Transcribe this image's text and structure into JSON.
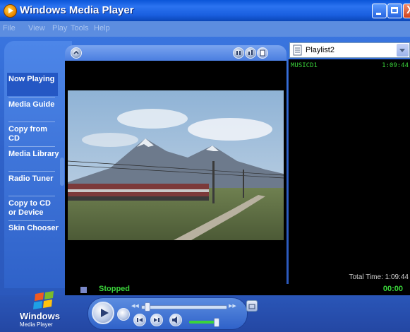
{
  "window": {
    "title": "Windows Media Player",
    "close_glyph": "X",
    "colors": {
      "titlebar": "#1a5fe0",
      "frame": "#2f62c9",
      "status_green": "#3ad43a"
    }
  },
  "menu": [
    "File",
    "View",
    "Play",
    "Tools",
    "Help"
  ],
  "taskbar": {
    "items": [
      {
        "label": "Now Playing",
        "active": true
      },
      {
        "label": "Media Guide"
      },
      {
        "label": "Copy from CD"
      },
      {
        "label": "Media Library"
      },
      {
        "label": "Radio Tuner"
      },
      {
        "label": "Copy to CD or Device"
      },
      {
        "label": "Skin Chooser"
      }
    ]
  },
  "playlist": {
    "selected": "Playlist2",
    "items": [
      {
        "title": "MUSICD1",
        "duration": "1:09:44"
      }
    ],
    "total_label": "Total Time: 1:09:44"
  },
  "status": {
    "state": "Stopped",
    "elapsed": "00:00"
  },
  "logo": {
    "line1": "Windows",
    "line2": "Media Player"
  },
  "icons": [
    "app-icon",
    "minimize-icon",
    "maximize-icon",
    "close-icon",
    "visualization-icon",
    "playlist-icon",
    "play-icon",
    "stop-icon",
    "previous-icon",
    "next-icon",
    "mute-icon",
    "shuffle-icon"
  ]
}
